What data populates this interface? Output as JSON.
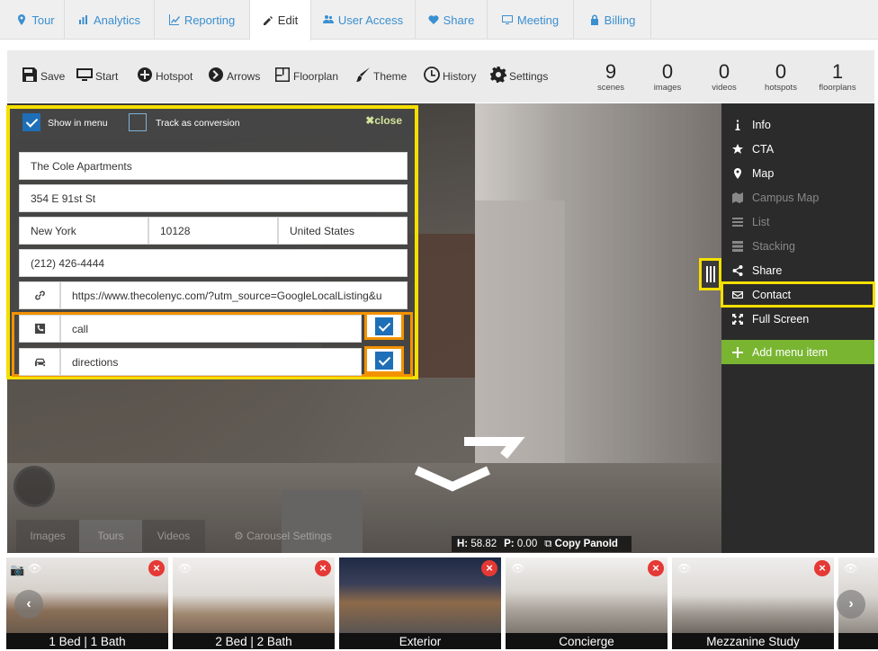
{
  "tabs": [
    {
      "label": "Tour",
      "icon": "map-marker-icon"
    },
    {
      "label": "Analytics",
      "icon": "bar-chart-icon"
    },
    {
      "label": "Reporting",
      "icon": "line-chart-icon"
    },
    {
      "label": "Edit",
      "icon": "pencil-icon"
    },
    {
      "label": "User Access",
      "icon": "users-icon"
    },
    {
      "label": "Share",
      "icon": "heart-icon"
    },
    {
      "label": "Meeting",
      "icon": "monitor-icon"
    },
    {
      "label": "Billing",
      "icon": "lock-icon"
    }
  ],
  "active_tab": "Edit",
  "toolbar": {
    "save": "Save",
    "start": "Start",
    "hotspot": "Hotspot",
    "arrows": "Arrows",
    "floorplan": "Floorplan",
    "theme": "Theme",
    "history": "History",
    "settings": "Settings"
  },
  "stats": [
    {
      "value": "9",
      "label": "scenes"
    },
    {
      "value": "0",
      "label": "images"
    },
    {
      "value": "0",
      "label": "videos"
    },
    {
      "value": "0",
      "label": "hotspots"
    },
    {
      "value": "1",
      "label": "floorplans"
    }
  ],
  "panel": {
    "show_in_menu": "Show in menu",
    "show_in_menu_checked": true,
    "track_conversion": "Track as conversion",
    "track_conversion_checked": false,
    "close": "close",
    "name": "The Cole Apartments",
    "street": "354 E 91st St",
    "city": "New York",
    "zip": "10128",
    "country": "United States",
    "phone": "(212) 426-4444",
    "url": "https://www.thecolenyc.com/?utm_source=GoogleLocalListing&u",
    "call_label": "call",
    "call_checked": true,
    "directions_label": "directions",
    "directions_checked": true
  },
  "viewer": {
    "bottom_tabs": [
      "Images",
      "Tours",
      "Videos"
    ],
    "carousel_settings": "Carousel Settings",
    "h_label": "H:",
    "h_value": "58.82",
    "p_label": "P:",
    "p_value": "0.00",
    "copy": "Copy PanoId"
  },
  "sidemenu": [
    {
      "label": "Info",
      "icon": "info-icon",
      "dim": false
    },
    {
      "label": "CTA",
      "icon": "star-icon",
      "dim": false
    },
    {
      "label": "Map",
      "icon": "map-pin-icon",
      "dim": false
    },
    {
      "label": "Campus Map",
      "icon": "campus-map-icon",
      "dim": true
    },
    {
      "label": "List",
      "icon": "list-icon",
      "dim": true
    },
    {
      "label": "Stacking",
      "icon": "stacking-icon",
      "dim": true
    },
    {
      "label": "Share",
      "icon": "share-icon",
      "dim": false
    },
    {
      "label": "Contact",
      "icon": "envelope-icon",
      "dim": false
    },
    {
      "label": "Full Screen",
      "icon": "fullscreen-icon",
      "dim": false
    }
  ],
  "add_menu_item": "Add menu item",
  "thumbnails": [
    {
      "caption": "1 Bed | 1 Bath"
    },
    {
      "caption": "2 Bed | 2 Bath"
    },
    {
      "caption": "Exterior"
    },
    {
      "caption": "Concierge"
    },
    {
      "caption": "Mezzanine Study"
    }
  ],
  "colors": {
    "accent_blue": "#3a8fd0",
    "highlight_yellow": "#f4df00",
    "highlight_orange": "#f39200",
    "add_green": "#79b531",
    "delete_red": "#e53935"
  }
}
